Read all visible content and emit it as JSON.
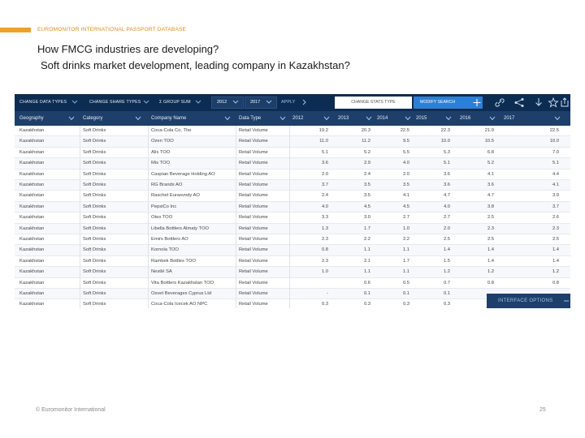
{
  "slide": {
    "header_label": "EUROMONITOR INTERNATIONAL PASSPORT DATABASE",
    "title": "How FMCG industries are developing?",
    "subtitle": "Soft drinks market development, leading company in Kazakhstan?",
    "footer_left": "© Euromonitor International",
    "page_number": "25",
    "accent_color": "#f0a024"
  },
  "toolbar": {
    "change_data_types": "CHANGE DATA TYPES",
    "change_share_types": "CHANGE SHARE TYPES",
    "group_sum": "Σ GROUP SUM",
    "year_from": "2012",
    "year_to": "2017",
    "apply": "APPLY",
    "change_stats_type": "CHANGE STATS TYPE",
    "modify_search": "MODIFY SEARCH",
    "icons": [
      "plus-icon",
      "link-icon",
      "share-icon",
      "download-icon",
      "star-icon",
      "export-icon"
    ]
  },
  "grid": {
    "columns": [
      "Geography",
      "Category",
      "Company Name",
      "Data Type",
      "2012",
      "2013",
      "2014",
      "2015",
      "2016",
      "2017"
    ],
    "rows": [
      [
        "Kazakhstan",
        "Soft Drinks",
        "Coca-Cola Co, The",
        "Retail Volume",
        "19.2",
        "20.3",
        "22.5",
        "22.3",
        "21.9",
        "22.5"
      ],
      [
        "Kazakhstan",
        "Soft Drinks",
        "Ozen TOO",
        "Retail Volume",
        "11.0",
        "11.2",
        "9.5",
        "10.0",
        "10.5",
        "10.0"
      ],
      [
        "Kazakhstan",
        "Soft Drinks",
        "Alix TOO",
        "Retail Volume",
        "5.1",
        "5.2",
        "5.5",
        "5.3",
        "6.8",
        "7.0"
      ],
      [
        "Kazakhstan",
        "Soft Drinks",
        "Mis TOO",
        "Retail Volume",
        "3.6",
        "2.9",
        "4.0",
        "5.1",
        "5.2",
        "5.1"
      ],
      [
        "Kazakhstan",
        "Soft Drinks",
        "Caspian Beverage Holding AO",
        "Retail Volume",
        "2.0",
        "2.4",
        "2.0",
        "3.6",
        "4.1",
        "4.4"
      ],
      [
        "Kazakhstan",
        "Soft Drinks",
        "RG Brands AO",
        "Retail Volume",
        "3.7",
        "3.5",
        "3.5",
        "3.6",
        "3.6",
        "4.1"
      ],
      [
        "Kazakhstan",
        "Soft Drinks",
        "Raschet Eurasvody AO",
        "Retail Volume",
        "2.4",
        "3.5",
        "4.1",
        "4.7",
        "4.7",
        "3.9"
      ],
      [
        "Kazakhstan",
        "Soft Drinks",
        "PepsiCo Inc",
        "Retail Volume",
        "4.0",
        "4.5",
        "4.5",
        "4.0",
        "3.8",
        "3.7"
      ],
      [
        "Kazakhstan",
        "Soft Drinks",
        "Otes TOO",
        "Retail Volume",
        "3.3",
        "3.0",
        "2.7",
        "2.7",
        "2.5",
        "2.6"
      ],
      [
        "Kazakhstan",
        "Soft Drinks",
        "Libella Bottlers Almaty TOO",
        "Retail Volume",
        "1.3",
        "1.7",
        "1.0",
        "2.0",
        "2.3",
        "2.3"
      ],
      [
        "Kazakhstan",
        "Soft Drinks",
        "Emirs Bottlers AO",
        "Retail Volume",
        "2.3",
        "2.2",
        "2.2",
        "2.5",
        "2.5",
        "2.5"
      ],
      [
        "Kazakhstan",
        "Soft Drinks",
        "Kornola TOO",
        "Retail Volume",
        "0.8",
        "1.1",
        "1.1",
        "1.4",
        "1.4",
        "1.4"
      ],
      [
        "Kazakhstan",
        "Soft Drinks",
        "Rambek Bottles TOO",
        "Retail Volume",
        "2.3",
        "2.1",
        "1.7",
        "1.5",
        "1.4",
        "1.4"
      ],
      [
        "Kazakhstan",
        "Soft Drinks",
        "Nestlé SA",
        "Retail Volume",
        "1.0",
        "1.1",
        "1.1",
        "1.2",
        "1.2",
        "1.2"
      ],
      [
        "Kazakhstan",
        "Soft Drinks",
        "Vita Bottlers Kazakhstan TOO",
        "Retail Volume",
        "",
        "0.6",
        "0.5",
        "0.7",
        "0.8",
        "0.8"
      ],
      [
        "Kazakhstan",
        "Soft Drinks",
        "Osvet Beverages Cyprus Ltd",
        "Retail Volume",
        "-",
        "0.1",
        "0.1",
        "0.1",
        "",
        ""
      ],
      [
        "Kazakhstan",
        "Soft Drinks",
        "Coca-Cola Icecek AO NPC",
        "Retail Volume",
        "0.3",
        "0.3",
        "0.3",
        "0.3",
        "",
        ""
      ]
    ]
  },
  "interface_options": "INTERFACE OPTIONS"
}
